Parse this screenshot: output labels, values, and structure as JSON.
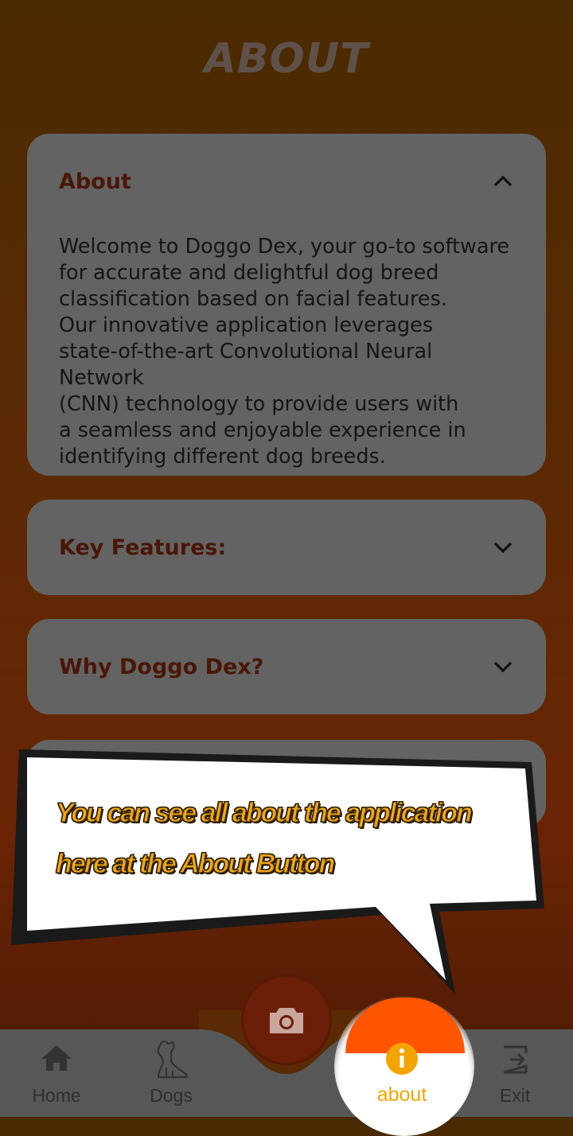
{
  "page": {
    "title": "ABOUT"
  },
  "sections": [
    {
      "title": "About",
      "expanded": true,
      "body": "Welcome to Doggo Dex, your go-to software\nfor accurate and delightful dog breed\nclassification based on facial features.\nOur innovative application leverages\nstate-of-the-art Convolutional Neural Network\n(CNN) technology to provide users with\na seamless and enjoyable experience in\nidentifying different dog breeds."
    },
    {
      "title": "Key Features:",
      "expanded": false
    },
    {
      "title": "Why Doggo Dex?",
      "expanded": false
    }
  ],
  "tooltip": {
    "line1": "You can see all about the application",
    "line2": "here at the About Button"
  },
  "nav": {
    "home": "Home",
    "dogs": "Dogs",
    "about": "about",
    "exit": "Exit"
  },
  "colors": {
    "accent": "#f4a400",
    "highlight": "#ff5500",
    "card": "#636363",
    "section_title": "#4a1606"
  },
  "icons": {
    "home": "home-icon",
    "dogs": "dog-icon",
    "camera": "camera-icon",
    "about": "info-icon",
    "exit": "exit-icon"
  }
}
